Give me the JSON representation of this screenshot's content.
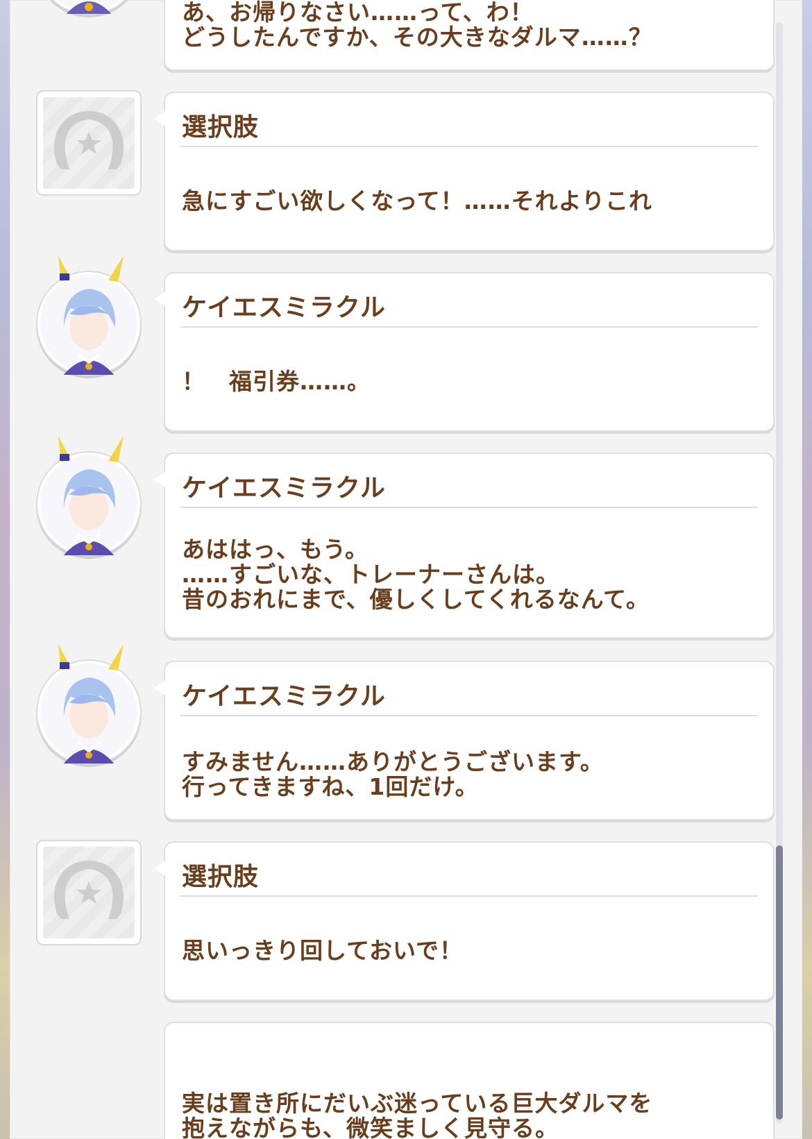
{
  "log": {
    "entries": [
      {
        "type": "character",
        "speaker": "",
        "text": "あ、お帰りなさい……って、わ！\nどうしたんですか、その大きなダルマ……？"
      },
      {
        "type": "choice",
        "speaker": "選択肢",
        "text": "急にすごい欲しくなって！……それよりこれ"
      },
      {
        "type": "character",
        "speaker": "ケイエスミラクル",
        "text": "！　福引券……。"
      },
      {
        "type": "character",
        "speaker": "ケイエスミラクル",
        "text": "あははっ、もう。\n……すごいな、トレーナーさんは。\n昔のおれにまで、優しくしてくれるなんて。"
      },
      {
        "type": "character",
        "speaker": "ケイエスミラクル",
        "text": "すみません……ありがとうございます。\n行ってきますね、1回だけ。"
      },
      {
        "type": "choice",
        "speaker": "選択肢",
        "text": "思いっきり回しておいで！"
      },
      {
        "type": "narration",
        "speaker": "",
        "text": "実は置き所にだいぶ迷っている巨大ダルマを\n抱えながらも、微笑ましく見守る。"
      }
    ]
  },
  "icons": {
    "choice_avatar": "horseshoe-star-icon",
    "character_avatar": "character-portrait"
  },
  "colors": {
    "text": "#6a3e1c",
    "panel": "#f3f3f3",
    "scroll_thumb": "#7f7f95"
  }
}
